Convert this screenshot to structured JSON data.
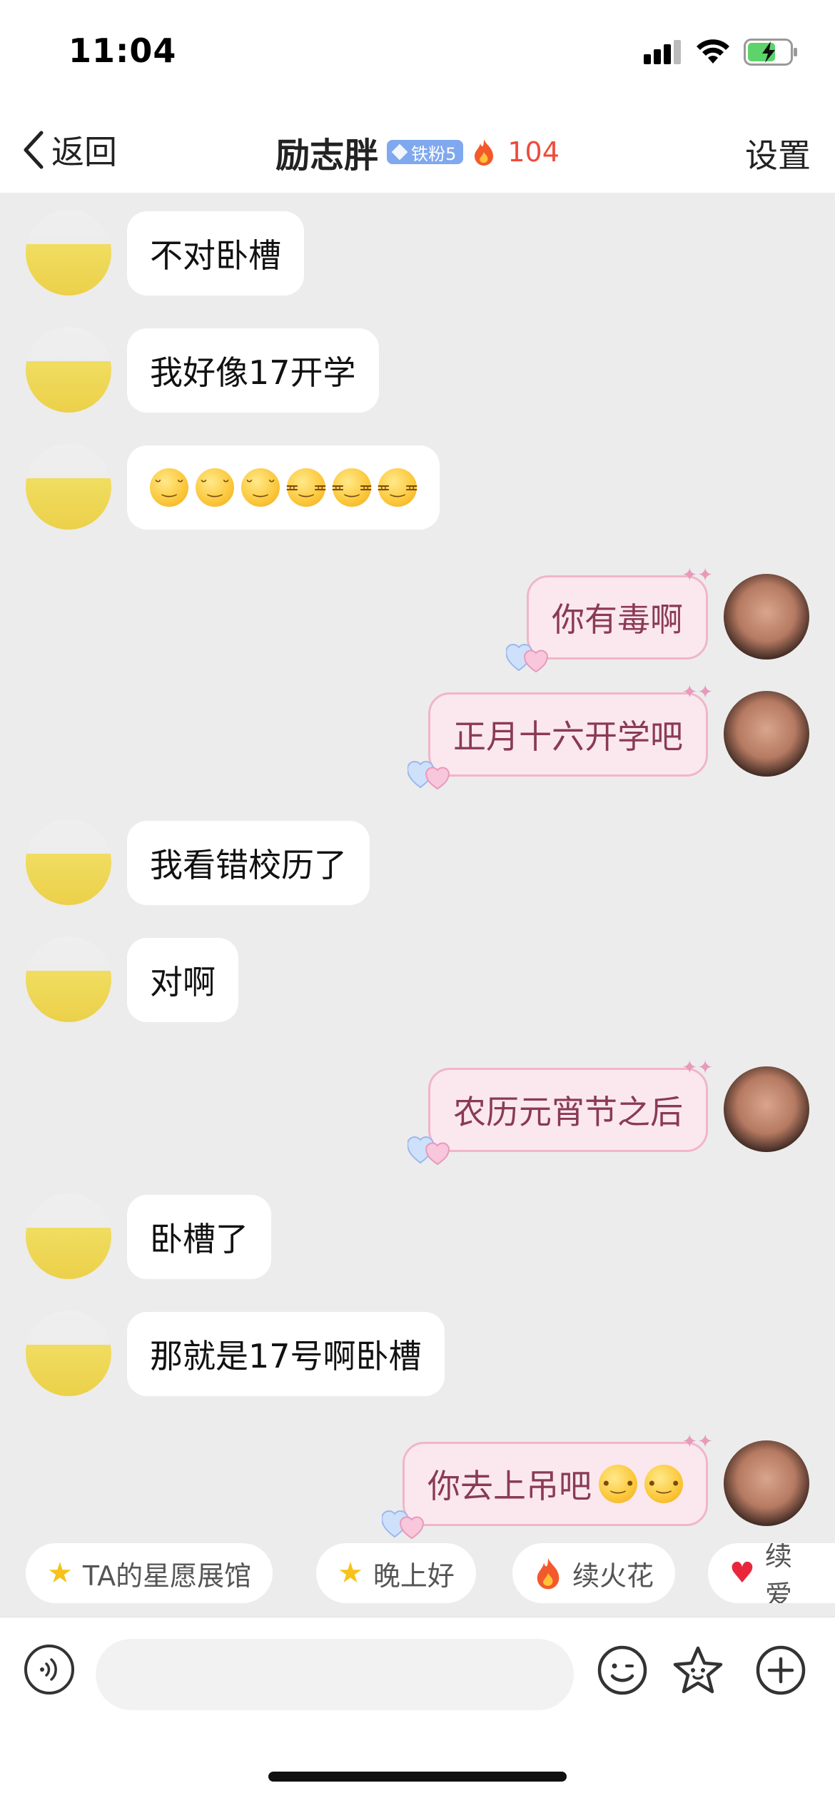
{
  "status_bar": {
    "time": "11:04"
  },
  "nav": {
    "back_label": "返回",
    "title": "励志胖",
    "fan_badge": "铁粉5",
    "streak_count": "104",
    "settings_label": "设置"
  },
  "messages": [
    {
      "side": "left",
      "text": "不对卧槽"
    },
    {
      "side": "left",
      "text": "我好像17开学"
    },
    {
      "side": "left",
      "emoji": [
        "downcast-sweat-face",
        "downcast-sweat-face",
        "downcast-sweat-face",
        "confused-grin-face",
        "confused-grin-face",
        "confused-grin-face"
      ]
    },
    {
      "side": "right",
      "text": "你有毒啊"
    },
    {
      "side": "right",
      "text": "正月十六开学吧"
    },
    {
      "side": "left",
      "text": "我看错校历了"
    },
    {
      "side": "left",
      "text": "对啊"
    },
    {
      "side": "right",
      "text": "农历元宵节之后"
    },
    {
      "side": "left",
      "text": "卧槽了"
    },
    {
      "side": "left",
      "text": "那就是17号啊卧槽"
    },
    {
      "side": "right",
      "text": "你去上吊吧",
      "emoji": [
        "slight-smile-face",
        "slight-smile-face"
      ]
    }
  ],
  "quick_chips": [
    {
      "icon": "star-icon",
      "label": "TA的星愿展馆"
    },
    {
      "icon": "smiling-star-icon",
      "label": "晚上好"
    },
    {
      "icon": "flame-icon",
      "label": "续火花"
    },
    {
      "icon": "heart-icon",
      "label": "续爱"
    }
  ],
  "input": {
    "placeholder": ""
  },
  "colors": {
    "chat_bg": "#ececec",
    "right_bubble": "#fbe8ef",
    "right_bubble_border": "#f2b5c8",
    "right_text": "#8a3a55",
    "fan_badge": "#7fa8ee",
    "streak": "#ee4b3b"
  }
}
